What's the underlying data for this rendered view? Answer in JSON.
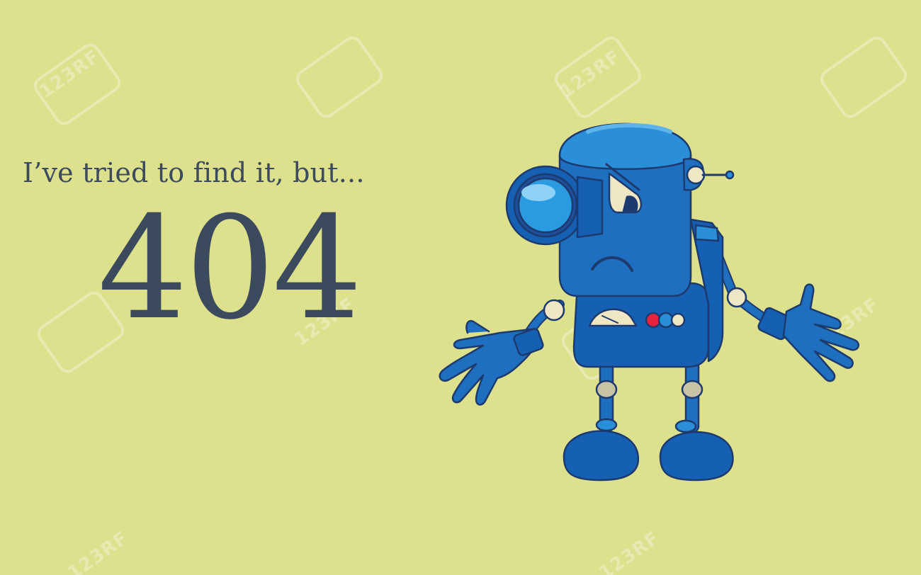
{
  "message": {
    "tagline": "I’ve tried to find it, but...",
    "code": "404"
  },
  "illustration": {
    "subject": "robot-icon"
  },
  "watermark": {
    "text": "123RF"
  },
  "colors": {
    "background": "#dde08d",
    "text": "#3b4a5c",
    "robot_body": "#1e6fc0",
    "robot_highlight": "#2a8fd8",
    "robot_outline": "#1d3a6e",
    "accent_red": "#e8243c",
    "joint": "#efe6c3"
  }
}
